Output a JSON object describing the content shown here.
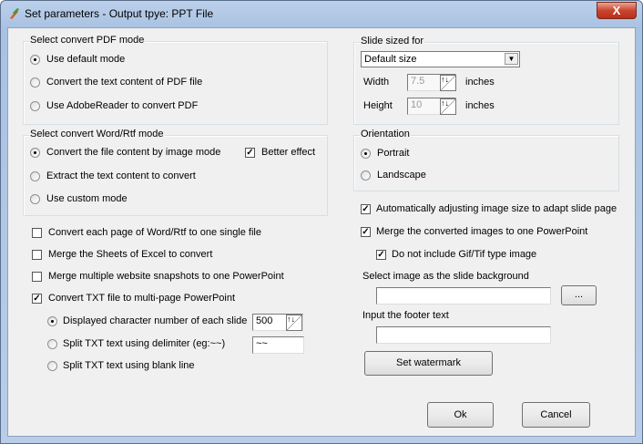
{
  "window": {
    "title": "Set parameters - Output tpye: PPT File",
    "close": "X"
  },
  "pdf_mode": {
    "label": "Select convert PDF mode",
    "options": [
      "Use default mode",
      "Convert the text content of PDF file",
      "Use AdobeReader to convert PDF"
    ],
    "selected": 0
  },
  "word_mode": {
    "label": "Select convert Word/Rtf mode",
    "options": [
      "Convert the file content by image mode",
      "Extract the text content to convert",
      "Use custom mode"
    ],
    "selected": 0,
    "better_effect": "Better effect",
    "better_effect_checked": true
  },
  "checks": [
    {
      "label": "Convert each page of Word/Rtf to one single file",
      "checked": false
    },
    {
      "label": "Merge the Sheets of Excel to convert",
      "checked": false
    },
    {
      "label": "Merge multiple website snapshots to one PowerPoint",
      "checked": false
    },
    {
      "label": "Convert TXT file to multi-page PowerPoint",
      "checked": true
    }
  ],
  "txt": {
    "options": [
      "Displayed character number of each slide",
      "Split TXT text using delimiter (eg:~~)",
      "Split TXT text using blank line"
    ],
    "selected": 0,
    "char_count": "500",
    "delimiter": "~~"
  },
  "slide": {
    "label": "Slide sized for",
    "size": "Default size",
    "width_label": "Width",
    "width": "7.5",
    "height_label": "Height",
    "height": "10",
    "unit": "inches"
  },
  "orientation": {
    "label": "Orientation",
    "options": [
      "Portrait",
      "Landscape"
    ],
    "selected": 0
  },
  "right_checks": [
    {
      "label": "Automatically adjusting image size to adapt slide page",
      "checked": true
    },
    {
      "label": "Merge the converted images to one PowerPoint",
      "checked": true
    },
    {
      "label": "Do not include Gif/Tif type image",
      "checked": true
    }
  ],
  "background": {
    "label": "Select image as the slide background",
    "value": "",
    "browse": "..."
  },
  "footer": {
    "label": "Input the footer text",
    "value": ""
  },
  "buttons": {
    "watermark": "Set watermark",
    "ok": "Ok",
    "cancel": "Cancel"
  }
}
